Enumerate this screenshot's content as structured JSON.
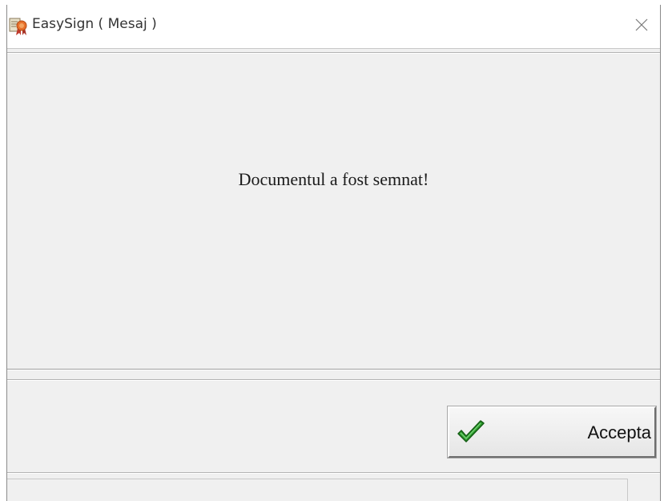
{
  "window": {
    "title": "EasySign ( Mesaj )"
  },
  "message": {
    "text": "Documentul a fost semnat!"
  },
  "buttons": {
    "accept_label": "Accepta"
  },
  "icons": {
    "app": "certificate-ribbon-icon",
    "close": "close-icon",
    "accept": "checkmark-icon"
  },
  "colors": {
    "checkmark": "#1e8a1e",
    "app_icon_ribbon": "#d9461e"
  }
}
